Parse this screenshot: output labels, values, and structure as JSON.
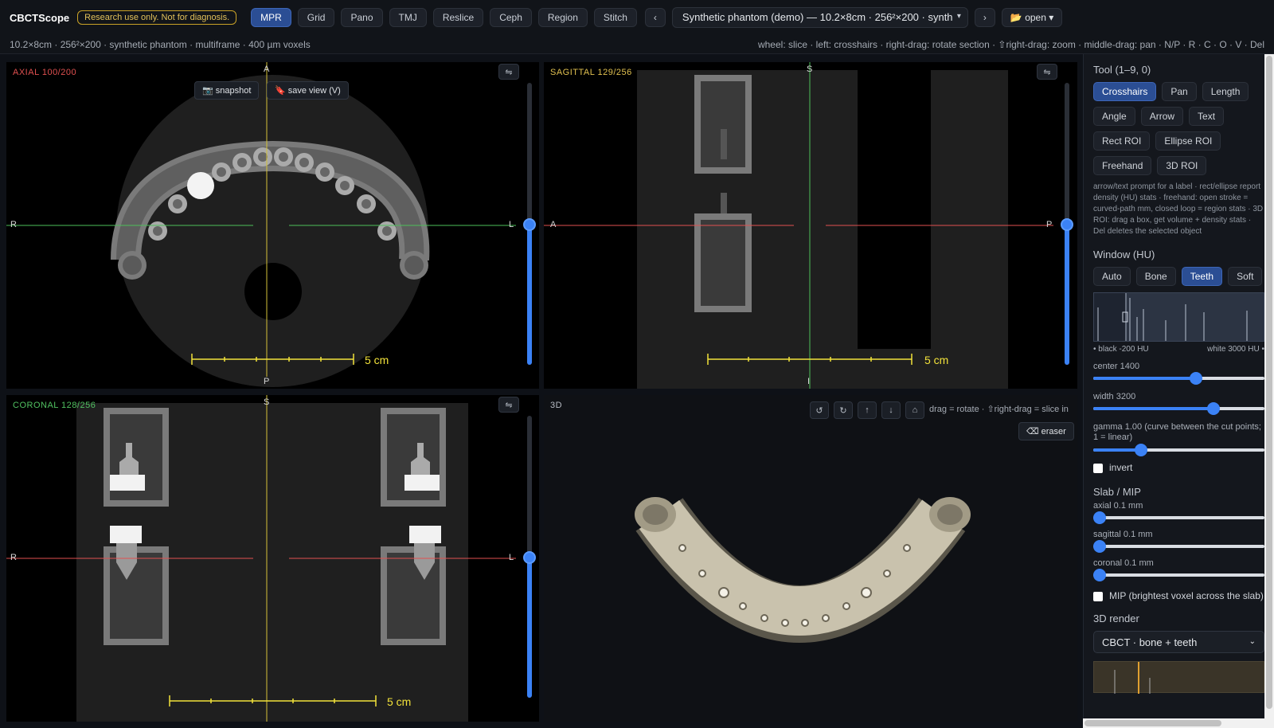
{
  "app": {
    "name": "CBCTScope",
    "warning": "Research use only. Not for diagnosis."
  },
  "toolbar": {
    "modes": [
      "MPR",
      "Grid",
      "Pano",
      "TMJ",
      "Reslice",
      "Ceph",
      "Region",
      "Stitch"
    ],
    "active_mode": "MPR",
    "prev_label": "‹",
    "next_label": "›",
    "dataset": "Synthetic phantom (demo) — 10.2×8cm · 256²×200 · synth",
    "open_label": "📂 open ▾"
  },
  "info": {
    "left": "10.2×8cm · 256²×200 · synthetic phantom · multiframe · 400 µm voxels",
    "right": "wheel: slice · left: crosshairs · right-drag: rotate section · ⇧right-drag: zoom · middle-drag: pan · N/P · R · C · O · V · Del"
  },
  "viewports": {
    "axial": {
      "label": "AXIAL 100/200",
      "top": "A",
      "bottom": "P",
      "left": "R",
      "right": "L",
      "scale": "5 cm",
      "snapshot": "📷 snapshot",
      "save_view": "🔖 save view (V)",
      "slice_fraction": 0.5
    },
    "sagittal": {
      "label": "SAGITTAL 129/256",
      "top": "S",
      "bottom": "I",
      "left": "A",
      "right": "P",
      "scale": "5 cm",
      "slice_fraction": 0.5
    },
    "coronal": {
      "label": "CORONAL 128/256",
      "top": "S",
      "left": "R",
      "right": "L",
      "scale": "5 cm",
      "slice_fraction": 0.5
    },
    "three_d": {
      "label": "3D",
      "hint": "drag = rotate · ⇧right-drag = slice in",
      "eraser": "⌫ eraser",
      "nav_icons": [
        "↺",
        "↻",
        "↑",
        "↓",
        "⌂"
      ]
    },
    "swap_icon": "⇋"
  },
  "panel": {
    "tool_title": "Tool (1–9, 0)",
    "tools": [
      "Crosshairs",
      "Pan",
      "Length",
      "Angle",
      "Arrow",
      "Text",
      "Rect ROI",
      "Ellipse ROI",
      "Freehand",
      "3D ROI"
    ],
    "active_tool": "Crosshairs",
    "tool_hint": "arrow/text prompt for a label · rect/ellipse report density (HU) stats · freehand: open stroke = curved-path mm, closed loop = region stats · 3D ROI: drag a box, get volume + density stats · Del deletes the selected object",
    "window_title": "Window (HU)",
    "window_presets": [
      "Auto",
      "Bone",
      "Teeth",
      "Soft"
    ],
    "active_window": "Teeth",
    "hist_left": "• black -200 HU",
    "hist_right": "white 3000 HU •",
    "center_label": "center 1400",
    "center_fraction": 0.6,
    "width_label": "width 3200",
    "width_fraction": 0.7,
    "gamma_label": "gamma 1.00 (curve between the cut points; 1 = linear)",
    "gamma_fraction": 0.28,
    "invert_label": "invert",
    "slab_title": "Slab / MIP",
    "axial_slab": "axial 0.1 mm",
    "sagittal_slab": "sagittal 0.1 mm",
    "coronal_slab": "coronal 0.1 mm",
    "mip_label": "MIP (brightest voxel across the slab)",
    "render_title": "3D render",
    "render_preset": "CBCT · bone + teeth"
  },
  "colors": {
    "accent": "#3b82f6",
    "axial": "#e05050",
    "sagittal": "#e0c050",
    "coronal": "#50c060",
    "scale": "#f2e23a"
  }
}
